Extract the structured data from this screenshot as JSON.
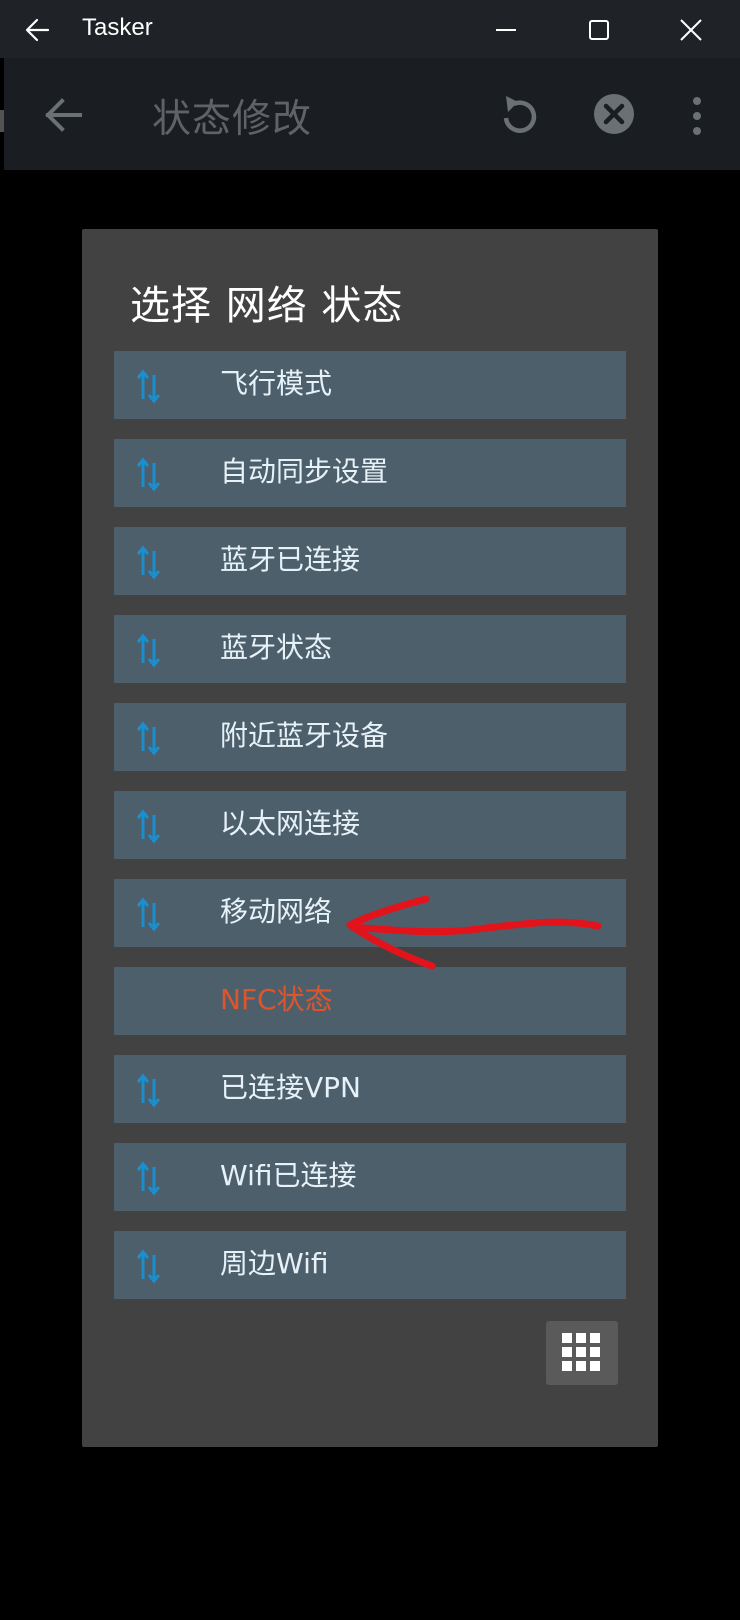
{
  "window": {
    "title": "Tasker"
  },
  "toolbar": {
    "title": "状态修改"
  },
  "dialog": {
    "title": "选择 网络 状态",
    "items": [
      {
        "label": "飞行模式",
        "icon": "network-arrows-icon"
      },
      {
        "label": "自动同步设置",
        "icon": "network-arrows-icon"
      },
      {
        "label": "蓝牙已连接",
        "icon": "network-arrows-icon"
      },
      {
        "label": "蓝牙状态",
        "icon": "network-arrows-icon"
      },
      {
        "label": "附近蓝牙设备",
        "icon": "network-arrows-icon"
      },
      {
        "label": "以太网连接",
        "icon": "network-arrows-icon"
      },
      {
        "label": "移动网络",
        "icon": "network-arrows-icon"
      },
      {
        "label": "NFC状态",
        "icon": "",
        "color": "#e0542a"
      },
      {
        "label": "已连接VPN",
        "icon": "network-arrows-icon"
      },
      {
        "label": "Wifi已连接",
        "icon": "network-arrows-icon"
      },
      {
        "label": "周边Wifi",
        "icon": "network-arrows-icon"
      }
    ]
  },
  "colors": {
    "item_bg": "#4e5f6c",
    "dialog_bg": "#424242",
    "icon_accent": "#1a8fcf",
    "annotation_red": "#e3131b"
  }
}
